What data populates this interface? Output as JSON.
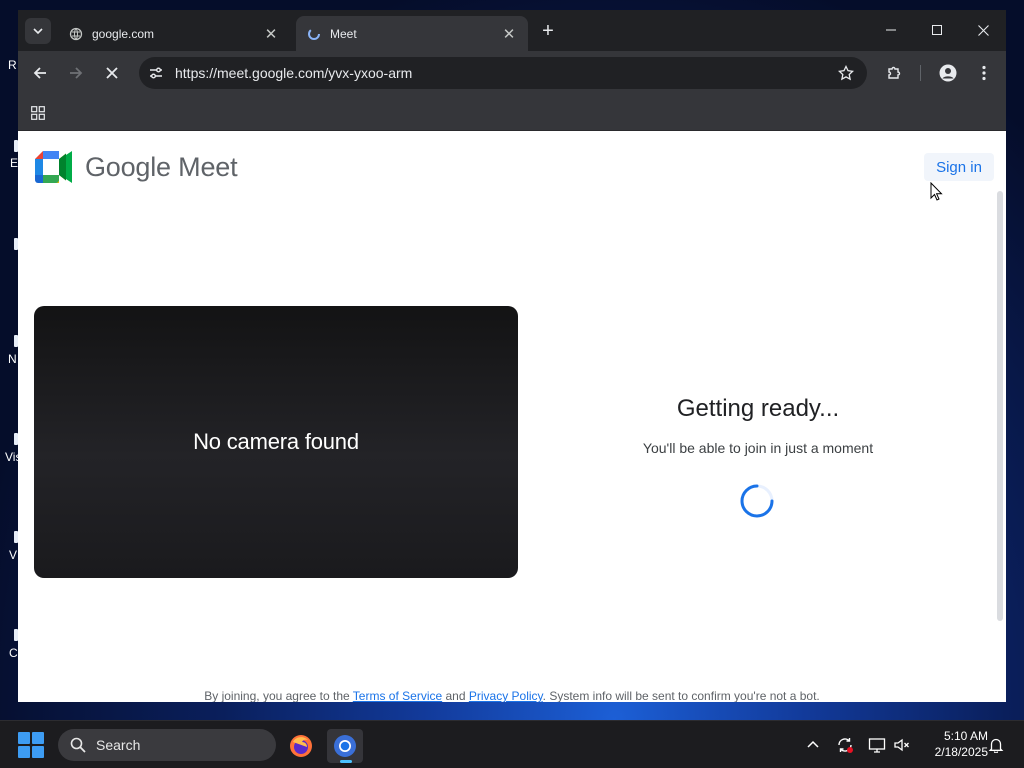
{
  "desktop": {
    "labels": [
      "R",
      "E",
      "N",
      "Vis",
      "V",
      "C"
    ]
  },
  "browser": {
    "tabs": [
      {
        "title": "google.com",
        "active": false
      },
      {
        "title": "Meet",
        "active": true
      }
    ],
    "url": "https://meet.google.com/yvx-yxoo-arm"
  },
  "page": {
    "brand": "Google Meet",
    "sign_in": "Sign in",
    "camera_status": "No camera found",
    "ready_title": "Getting ready...",
    "ready_subtitle": "You'll be able to join in just a moment",
    "legal": {
      "prefix": "By joining, you agree to the ",
      "terms": "Terms of Service",
      "and": " and ",
      "privacy": "Privacy Policy",
      "suffix": ". System info will be sent to confirm you're not a bot."
    }
  },
  "taskbar": {
    "search_label": "Search",
    "time": "5:10 AM",
    "date": "2/18/2025"
  },
  "colors": {
    "accent": "#1a73e8",
    "chrome_dark": "#202124",
    "chrome_toolbar": "#35363a"
  }
}
